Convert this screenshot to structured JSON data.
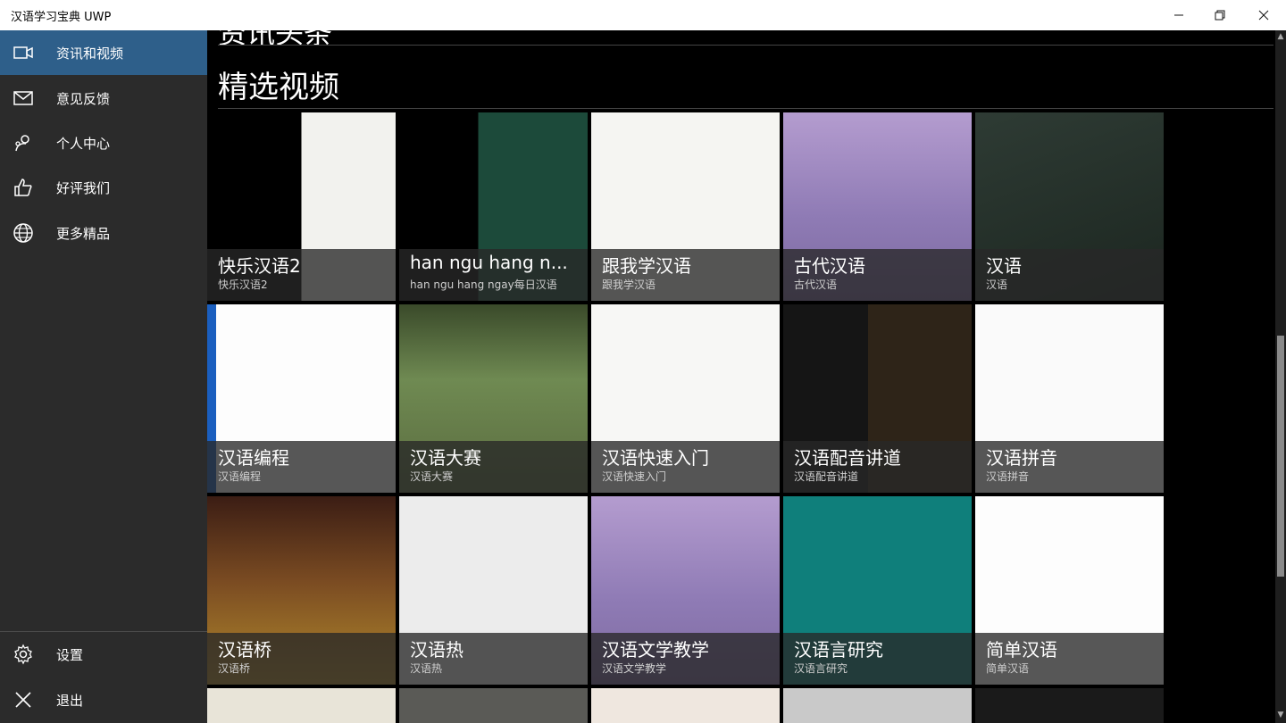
{
  "window": {
    "title": "汉语学习宝典 UWP",
    "minimize": "—",
    "maximize": "❐",
    "close": "✕"
  },
  "sidebar": {
    "items": [
      {
        "label": "资讯和视频",
        "icon": "video-camera-icon",
        "active": true
      },
      {
        "label": "意见反馈",
        "icon": "mail-icon"
      },
      {
        "label": "个人中心",
        "icon": "person-icon"
      },
      {
        "label": "好评我们",
        "icon": "thumbs-up-icon"
      },
      {
        "label": "更多精品",
        "icon": "globe-icon"
      }
    ],
    "bottom_items": [
      {
        "label": "设置",
        "icon": "gear-icon"
      },
      {
        "label": "退出",
        "icon": "close-icon"
      }
    ],
    "active_color": "#2e5f8a"
  },
  "main": {
    "previous_heading": "资讯头条",
    "section_title": "精选视频",
    "videos": [
      {
        "title": "快乐汉语2",
        "subtitle": "快乐汉语2"
      },
      {
        "title": "han ngu hang n...",
        "subtitle": "han ngu hang ngay每日汉语"
      },
      {
        "title": "跟我学汉语",
        "subtitle": "跟我学汉语"
      },
      {
        "title": "古代汉语",
        "subtitle": "古代汉语"
      },
      {
        "title": "汉语",
        "subtitle": "汉语"
      },
      {
        "title": "汉语编程",
        "subtitle": "汉语编程"
      },
      {
        "title": "汉语大赛",
        "subtitle": "汉语大赛"
      },
      {
        "title": "汉语快速入门",
        "subtitle": "汉语快速入门"
      },
      {
        "title": "汉语配音讲道",
        "subtitle": "汉语配音讲道"
      },
      {
        "title": "汉语拼音",
        "subtitle": "汉语拼音"
      },
      {
        "title": "汉语桥",
        "subtitle": "汉语桥"
      },
      {
        "title": "汉语热",
        "subtitle": "汉语热"
      },
      {
        "title": "汉语文学教学",
        "subtitle": "汉语文学教学"
      },
      {
        "title": "汉语言研究",
        "subtitle": "汉语言研究"
      },
      {
        "title": "简单汉语",
        "subtitle": "简单汉语"
      }
    ]
  },
  "scrollbar": {
    "up": "▲",
    "down": "▼"
  }
}
